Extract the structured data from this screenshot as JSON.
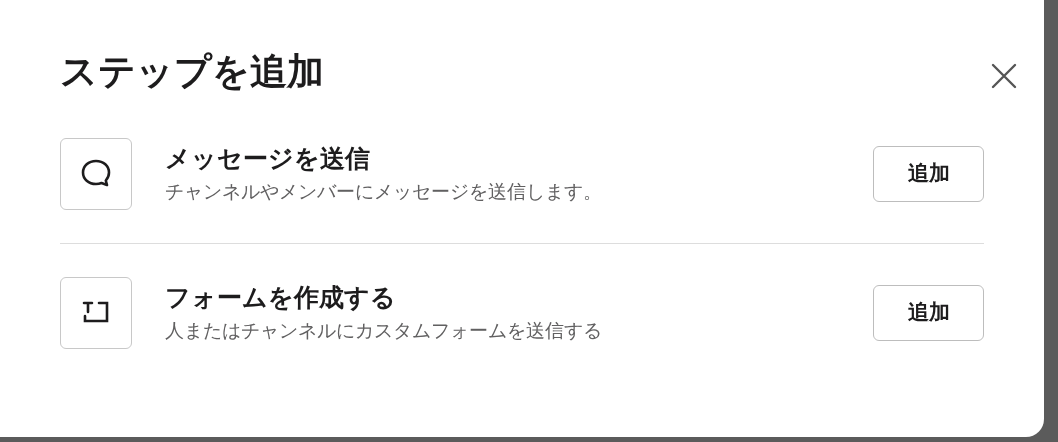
{
  "dialog": {
    "title": "ステップを追加"
  },
  "steps": [
    {
      "kind": "message",
      "title": "メッセージを送信",
      "description": "チャンネルやメンバーにメッセージを送信します。",
      "button": "追加"
    },
    {
      "kind": "form",
      "title": "フォームを作成する",
      "description": "人またはチャンネルにカスタムフォームを送信する",
      "button": "追加"
    }
  ]
}
